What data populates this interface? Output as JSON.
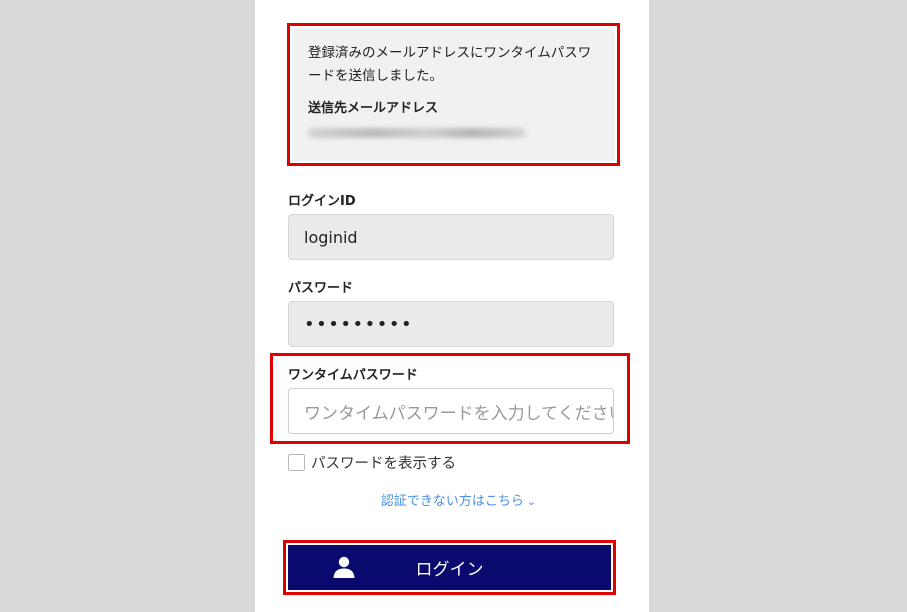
{
  "notice": {
    "message": "登録済みのメールアドレスにワンタイムパスワードを送信しました。",
    "email_label": "送信先メールアドレス"
  },
  "login_id": {
    "label": "ログインID",
    "value": "loginid"
  },
  "password": {
    "label": "パスワード",
    "value": "•••••••••"
  },
  "otp": {
    "label": "ワンタイムパスワード",
    "placeholder": "ワンタイムパスワードを入力してください"
  },
  "show_password": {
    "label": "パスワードを表示する"
  },
  "help": {
    "link": "認証できない方はこちら",
    "chevron": "⌄"
  },
  "login_button": {
    "label": "ログイン",
    "icon": "user-icon"
  },
  "colors": {
    "highlight": "#e00000",
    "button": "#0a0a6e",
    "link": "#4a90e2"
  }
}
